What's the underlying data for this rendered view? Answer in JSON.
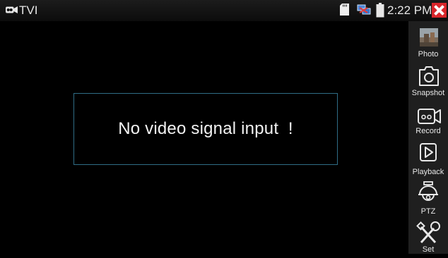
{
  "status_bar": {
    "app_title": "TVI",
    "time": "2:22 PM",
    "icons": [
      "camera-icon",
      "sd-card-icon",
      "network-icon",
      "battery-icon",
      "close-icon"
    ]
  },
  "video": {
    "message": "No video signal input  !"
  },
  "toolbar": {
    "items": [
      {
        "id": "photo",
        "label": "Photo",
        "icon": "photo-thumbnail-icon"
      },
      {
        "id": "snapshot",
        "label": "Snapshot",
        "icon": "camera-icon"
      },
      {
        "id": "record",
        "label": "Record",
        "icon": "video-camera-icon"
      },
      {
        "id": "playback",
        "label": "Playback",
        "icon": "play-icon"
      },
      {
        "id": "ptz",
        "label": "PTZ",
        "icon": "dome-camera-icon"
      },
      {
        "id": "set",
        "label": "Set",
        "icon": "tools-icon"
      }
    ]
  },
  "colors": {
    "accent_border": "#2f6d86",
    "close_red": "#d9262b"
  }
}
